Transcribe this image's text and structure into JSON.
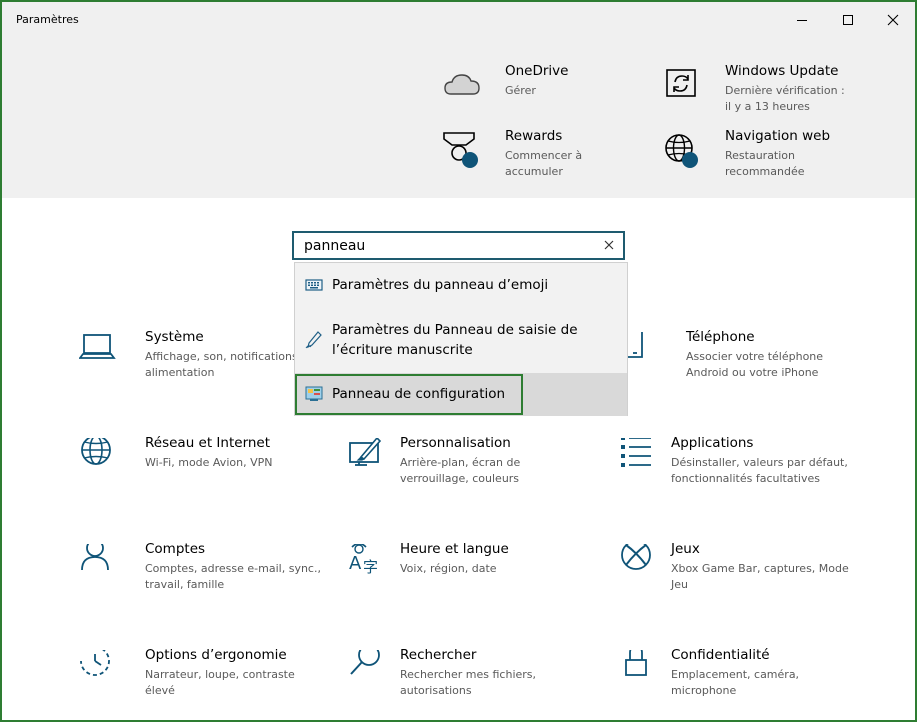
{
  "window": {
    "title": "Paramètres"
  },
  "top_tiles": [
    {
      "title": "OneDrive",
      "subtitle": [
        "Gérer"
      ]
    },
    {
      "title": "Windows Update",
      "subtitle": [
        "Dernière vérification :",
        "il y a 13 heures"
      ]
    },
    {
      "title": "Rewards",
      "subtitle": [
        "Commencer à",
        "accumuler"
      ]
    },
    {
      "title": "Navigation web",
      "subtitle": [
        "Restauration",
        "recommandée"
      ]
    }
  ],
  "search": {
    "value": "panneau"
  },
  "suggestions": [
    {
      "label": "Paramètres du panneau d’emoji"
    },
    {
      "label": [
        "Paramètres du Panneau de saisie de",
        "l’écriture manuscrite"
      ]
    },
    {
      "label": "Panneau de configuration"
    }
  ],
  "categories": [
    {
      "title": "Système",
      "subtitle": [
        "Affichage, son, notifications,",
        "alimentation"
      ]
    },
    {
      "title": "Téléphone",
      "subtitle": [
        "Associer votre téléphone",
        "Android ou votre iPhone"
      ]
    },
    {
      "title": "Réseau et Internet",
      "subtitle": [
        "Wi-Fi, mode Avion, VPN"
      ]
    },
    {
      "title": "Personnalisation",
      "subtitle": [
        "Arrière-plan, écran de",
        "verrouillage, couleurs"
      ]
    },
    {
      "title": "Applications",
      "subtitle": [
        "Désinstaller, valeurs par défaut,",
        "fonctionnalités facultatives"
      ]
    },
    {
      "title": "Comptes",
      "subtitle": [
        "Comptes, adresse e-mail, sync.,",
        "travail, famille"
      ]
    },
    {
      "title": "Heure et langue",
      "subtitle": [
        "Voix, région, date"
      ]
    },
    {
      "title": "Jeux",
      "subtitle": [
        "Xbox Game Bar, captures, Mode",
        "Jeu"
      ]
    },
    {
      "title": "Options d’ergonomie",
      "subtitle": [
        "Narrateur, loupe, contraste",
        "élevé"
      ]
    },
    {
      "title": "Rechercher",
      "subtitle": [
        "Rechercher mes fichiers,",
        "autorisations"
      ]
    },
    {
      "title": "Confidentialité",
      "subtitle": [
        "Emplacement, caméra,",
        "microphone"
      ]
    }
  ],
  "colors": {
    "accent": "#005a9e",
    "icon_blue": "#0f5478",
    "selection_outline": "#2e7d32",
    "top_band": "#f0f0f0"
  }
}
